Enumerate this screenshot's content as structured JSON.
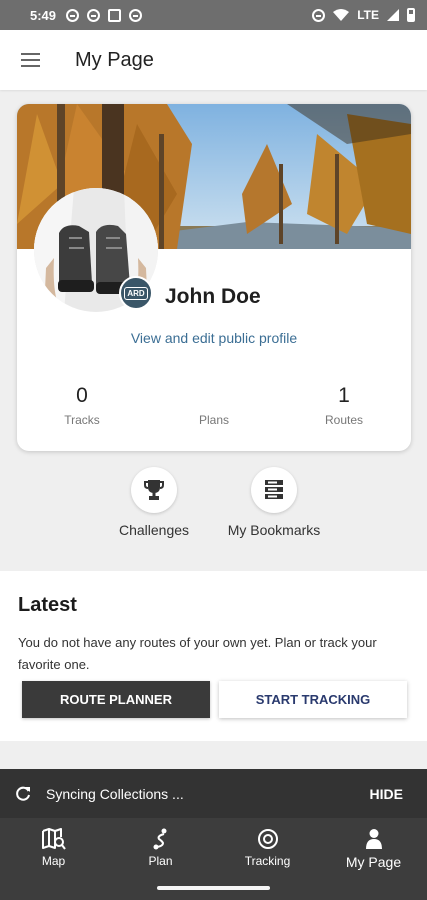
{
  "status_bar": {
    "time": "5:49",
    "network": "LTE"
  },
  "app_bar": {
    "title": "My Page",
    "menu_icon": "hamburger-menu-icon"
  },
  "profile": {
    "name": "John Doe",
    "edit_link": "View and edit public profile",
    "stats": [
      {
        "value": "0",
        "label": "Tracks"
      },
      {
        "value": "",
        "label": "Plans"
      },
      {
        "value": "1",
        "label": "Routes"
      }
    ]
  },
  "shortcuts": [
    {
      "label": "Challenges",
      "icon": "trophy-icon"
    },
    {
      "label": "My Bookmarks",
      "icon": "bookmarks-icon"
    }
  ],
  "latest": {
    "title": "Latest",
    "message": "You do not have any routes of your own yet. Plan or track your favorite one.",
    "route_planner_label": "ROUTE PLANNER",
    "start_tracking_label": "START TRACKING"
  },
  "snackbar": {
    "text": "Syncing Collections ...",
    "action": "HIDE"
  },
  "bottom_nav": [
    {
      "label": "Map",
      "icon": "map-search-icon"
    },
    {
      "label": "Plan",
      "icon": "route-plan-icon"
    },
    {
      "label": "Tracking",
      "icon": "target-icon"
    },
    {
      "label": "My Page",
      "icon": "person-icon",
      "active": true
    }
  ],
  "colors": {
    "link": "#3b6e94",
    "dark_button": "#3a3a3a",
    "nav_background": "#3d3d3d",
    "snackbar": "#333333"
  }
}
